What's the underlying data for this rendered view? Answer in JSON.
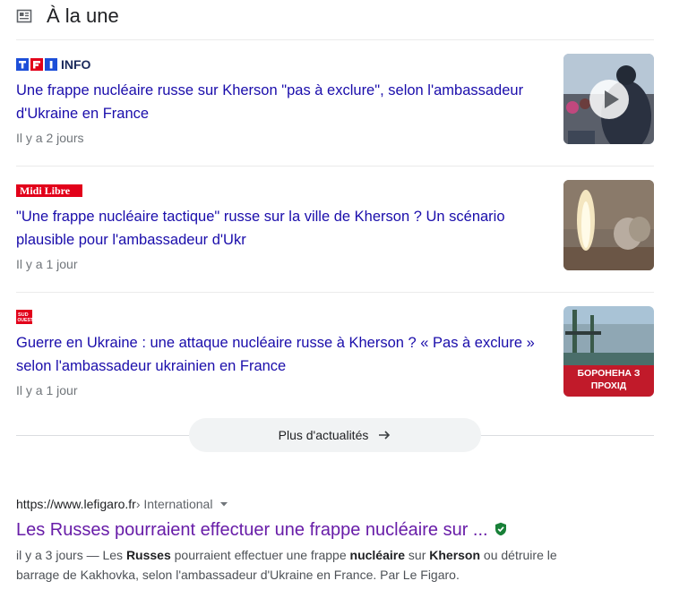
{
  "section": {
    "title": "À la une",
    "icon": "newspaper-icon"
  },
  "articles": [
    {
      "source": "TF1 INFO",
      "headline": "Une frappe nucléaire russe sur Kherson \"pas à exclure\", selon l'ambassadeur d'Ukraine en France",
      "age": "Il y a 2 jours",
      "thumb_icon": "play-icon"
    },
    {
      "source": "Midi Libre",
      "headline": "\"Une frappe nucléaire tactique\" russe sur la ville de Kherson ? Un scénario plausible pour l'ambassadeur d'Ukr",
      "age": "Il y a 1 jour"
    },
    {
      "source": "Sud Ouest",
      "headline": "Guerre en Ukraine : une attaque nucléaire russe à Kherson ? « Pas à exclure » selon l'ambassadeur ukrainien en France",
      "age": "Il y a 1 jour",
      "thumb_text": "БОРОНЕНА З ПРОХІД"
    }
  ],
  "more_news": {
    "label": "Plus d'actualités",
    "icon": "arrow-right-icon"
  },
  "result": {
    "url": "https://www.lefigaro.fr",
    "breadcrumb": " › International",
    "title": "Les Russes pourraient effectuer une frappe nucléaire sur ...",
    "snippet": {
      "p1": "il y a 3 jours — Les ",
      "b1": "Russes",
      "p2": " pourraient effectuer une frappe ",
      "b2": "nucléaire",
      "p3": " sur ",
      "b3": "Kherson",
      "p4": " ou détruire le barrage de Kakhovka, selon l'ambassadeur d'Ukraine en France. Par Le Figaro."
    }
  },
  "colors": {
    "link": "#1a0dab",
    "visited": "#681da8",
    "meta": "#70757a"
  }
}
